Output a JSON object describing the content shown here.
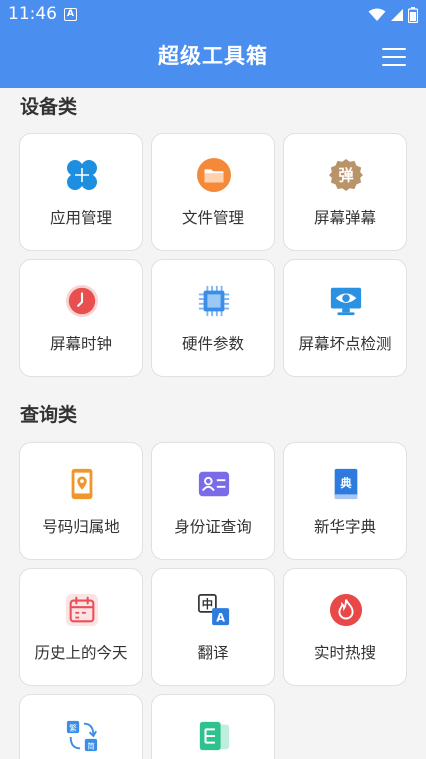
{
  "status_bar": {
    "time": "11:46",
    "notification_glyph": "A"
  },
  "header": {
    "title": "超级工具箱",
    "menu_icon": "hamburger-menu-icon",
    "background_color": "#4a8ef0"
  },
  "sections": [
    {
      "title": "设备类",
      "tools": [
        {
          "label": "应用管理",
          "icon": "apps-clover-icon",
          "color": "#1e8fe0"
        },
        {
          "label": "文件管理",
          "icon": "folder-icon",
          "color": "#f5893a"
        },
        {
          "label": "屏幕弹幕",
          "icon": "danmaku-badge-icon",
          "color": "#b99468",
          "glyph": "弹"
        },
        {
          "label": "屏幕时钟",
          "icon": "clock-icon",
          "color": "#e85050"
        },
        {
          "label": "硬件参数",
          "icon": "chip-icon",
          "color": "#3a8ee8"
        },
        {
          "label": "屏幕坏点检测",
          "icon": "monitor-eye-icon",
          "color": "#2a92e0"
        }
      ]
    },
    {
      "title": "查询类",
      "tools": [
        {
          "label": "号码归属地",
          "icon": "phone-location-icon",
          "color": "#f0962a"
        },
        {
          "label": "身份证查询",
          "icon": "id-card-icon",
          "color": "#7a6ce8"
        },
        {
          "label": "新华字典",
          "icon": "dictionary-book-icon",
          "color": "#2e7be0",
          "glyph": "典"
        },
        {
          "label": "历史上的今天",
          "icon": "calendar-icon",
          "color": "#e8505a"
        },
        {
          "label": "翻译",
          "icon": "translate-icon",
          "color": "#2e7be0",
          "glyph": "中",
          "glyph2": "A"
        },
        {
          "label": "实时热搜",
          "icon": "flame-icon",
          "color": "#e84848"
        },
        {
          "label": "",
          "icon": "convert-arrows-icon",
          "color": "#3a8ee8",
          "glyph": "繁",
          "glyph2": "简"
        },
        {
          "label": "",
          "icon": "document-green-icon",
          "color": "#2ec28e"
        }
      ]
    }
  ]
}
